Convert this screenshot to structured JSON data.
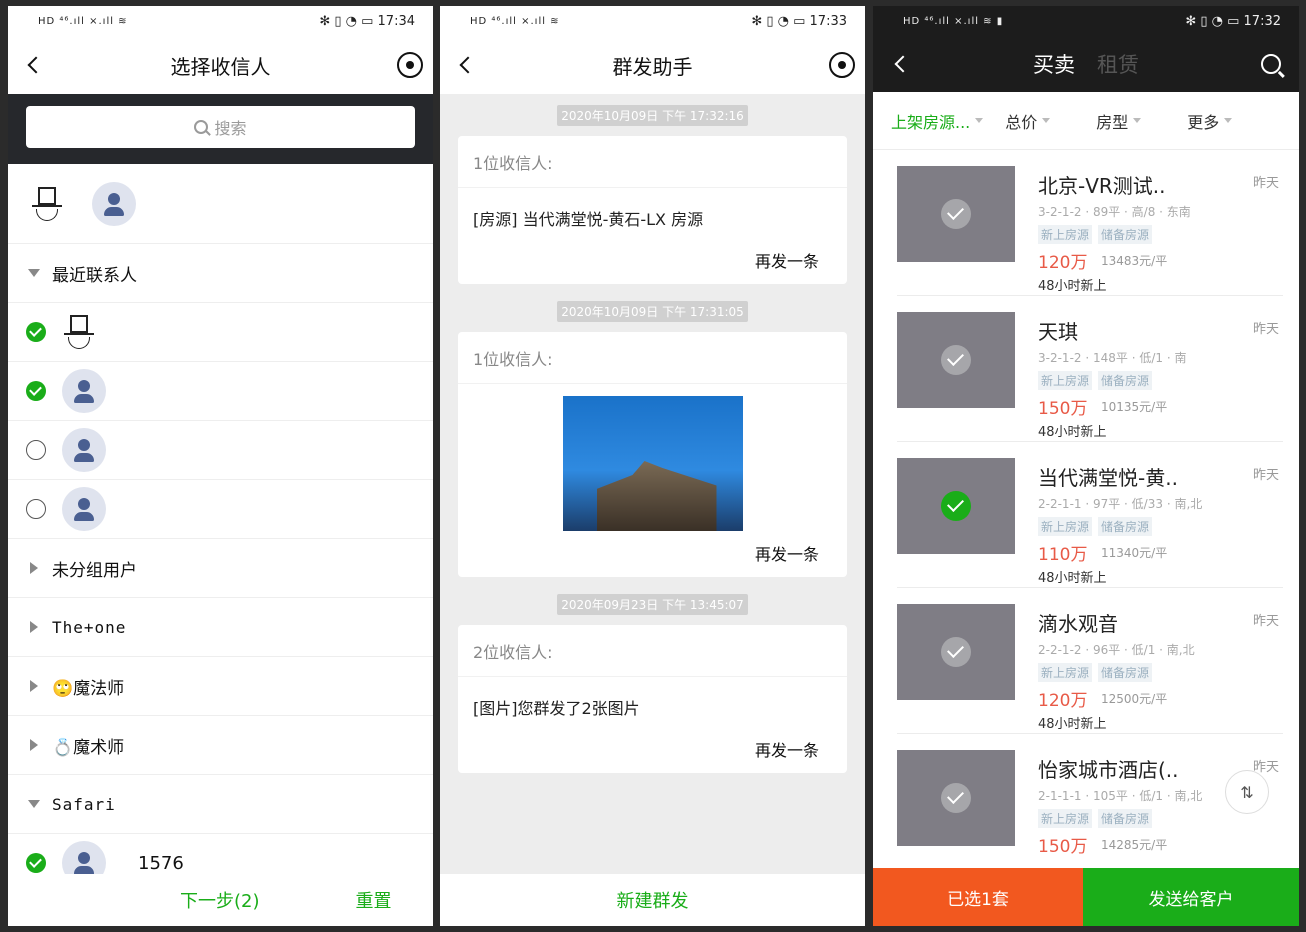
{
  "phone1": {
    "status": {
      "left": "HD ⁴⁶.ıll ×.ıll ≋",
      "right": "✻ ▯ ◔ ▭ 17:34"
    },
    "title": "选择收信人",
    "search_placeholder": "搜索",
    "groups": {
      "recent": "最近联系人",
      "ungrouped": "未分组用户",
      "theone": "The+one",
      "magician": "🙄魔法师",
      "illusionist": "💍魔术师",
      "safari": "Safari"
    },
    "contact_1576": "1576",
    "next_label": "下一步(2)",
    "reset_label": "重置"
  },
  "phone2": {
    "status": {
      "left": "HD ⁴⁶.ıll ×.ıll ≋",
      "right": "✻ ▯ ◔ ▭ 17:33"
    },
    "title": "群发助手",
    "messages": [
      {
        "time": "2020年10月09日 下午 17:32:16",
        "recipients": "1位收信人:",
        "content": "[房源] 当代满堂悦-黄石-LX 房源",
        "resend": "再发一条"
      },
      {
        "time": "2020年10月09日 下午 17:31:05",
        "recipients": "1位收信人:",
        "resend": "再发一条"
      },
      {
        "time": "2020年09月23日 下午 13:45:07",
        "recipients": "2位收信人:",
        "content": "[图片]您群发了2张图片",
        "resend": "再发一条"
      }
    ],
    "new_broadcast": "新建群发"
  },
  "phone3": {
    "status": {
      "left": "HD ⁴⁶.ıll ×.ıll ≋ ▮",
      "right": "✻ ▯ ◔ ▭ 17:32"
    },
    "tab_buy": "买卖",
    "tab_rent": "租赁",
    "filters": [
      "上架房源...",
      "总价",
      "房型",
      "更多"
    ],
    "listings": [
      {
        "title": "北京-VR测试..",
        "spec": "3-2-1-2 · 89平 · 高/8 · 东南",
        "tag1": "新上房源",
        "tag2": "储备房源",
        "price": "120万",
        "unit": "13483元/平",
        "fresh": "48小时新上",
        "when": "昨天",
        "selected": false
      },
      {
        "title": "天琪",
        "spec": "3-2-1-2 · 148平 · 低/1 · 南",
        "tag1": "新上房源",
        "tag2": "储备房源",
        "price": "150万",
        "unit": "10135元/平",
        "fresh": "48小时新上",
        "when": "昨天",
        "selected": false
      },
      {
        "title": "当代满堂悦-黄..",
        "spec": "2-2-1-1 · 97平 · 低/33 · 南,北",
        "tag1": "新上房源",
        "tag2": "储备房源",
        "price": "110万",
        "unit": "11340元/平",
        "fresh": "48小时新上",
        "when": "昨天",
        "selected": true
      },
      {
        "title": "滴水观音",
        "spec": "2-2-1-2 · 96平 · 低/1 · 南,北",
        "tag1": "新上房源",
        "tag2": "储备房源",
        "price": "120万",
        "unit": "12500元/平",
        "fresh": "48小时新上",
        "when": "昨天",
        "selected": false
      },
      {
        "title": "怡家城市酒店(..",
        "spec": "2-1-1-1 · 105平 · 低/1 · 南,北",
        "tag1": "新上房源",
        "tag2": "储备房源",
        "price": "150万",
        "unit": "14285元/平",
        "fresh": "",
        "when": "昨天",
        "selected": false
      }
    ],
    "selected_count": "已选1套",
    "send_label": "发送给客户"
  },
  "colors": {
    "accent_green": "#1aad19",
    "orange": "#f2581f",
    "price_red": "#e85a47"
  }
}
